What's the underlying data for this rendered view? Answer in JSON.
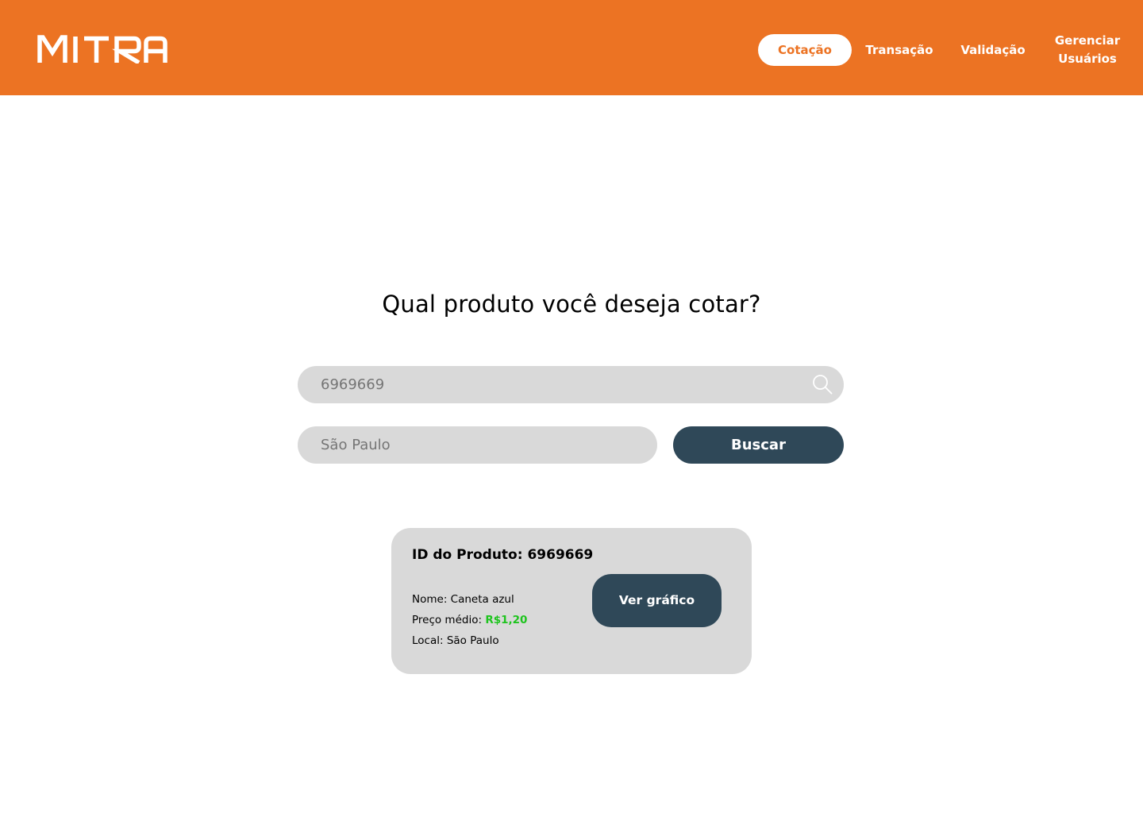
{
  "header": {
    "logo_text": "MITRA",
    "nav": [
      {
        "label": "Cotação",
        "active": true
      },
      {
        "label": "Transação",
        "active": false
      },
      {
        "label": "Validação",
        "active": false
      },
      {
        "label_line1": "Gerenciar",
        "label_line2": "Usuários",
        "active": false
      }
    ]
  },
  "main": {
    "question": "Qual produto você deseja cotar?",
    "search": {
      "placeholder": "6969669",
      "icon": "search-icon"
    },
    "location": {
      "placeholder": "São Paulo"
    },
    "search_button_label": "Buscar"
  },
  "result": {
    "title_prefix": "ID do Produto: ",
    "product_id": "6969669",
    "name_label": "Nome: ",
    "name_value": "Caneta azul",
    "price_label": "Preço médio: ",
    "price_value": "R$1,20",
    "location_label": "Local: ",
    "location_value": "São Paulo",
    "chart_button_label": "Ver gráfico"
  },
  "colors": {
    "brand_orange": "#ec7323",
    "dark_button": "#2f4858",
    "field_gray": "#d9d9d9",
    "price_green": "#1ec41e"
  }
}
